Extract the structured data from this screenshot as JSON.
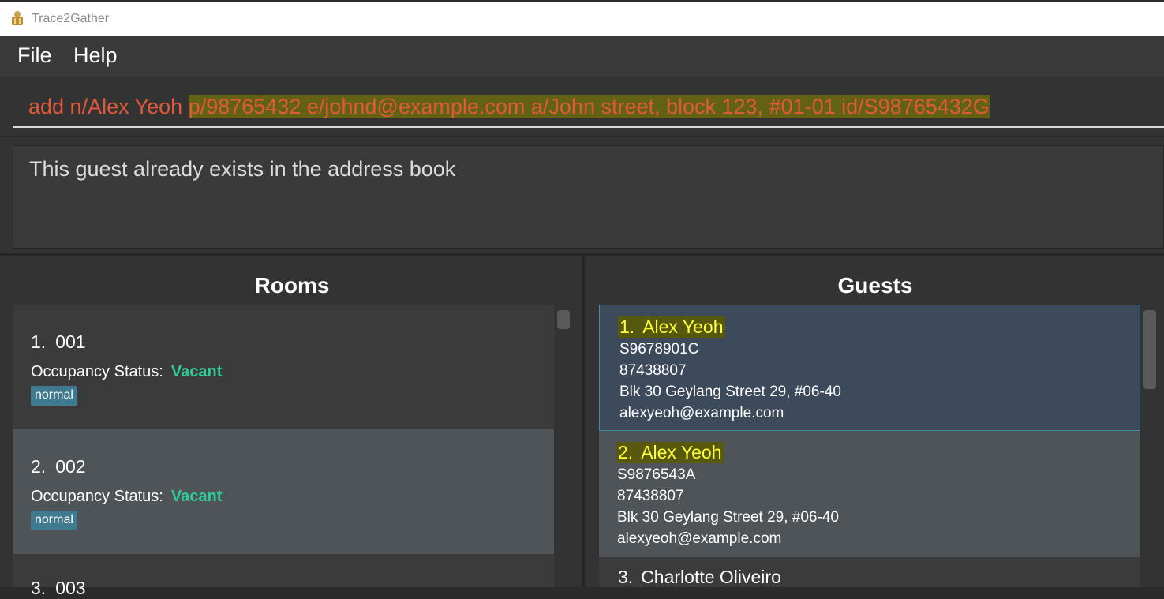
{
  "window": {
    "title": "Trace2Gather"
  },
  "menu": {
    "file": "File",
    "help": "Help"
  },
  "command": {
    "plain": "add n/Alex Yeoh ",
    "highlighted": "p/98765432 e/johnd@example.com a/John street, block 123, #01-01 id/S98765432G"
  },
  "result": {
    "text": "This guest already exists in the address book"
  },
  "rooms": {
    "title": "Rooms",
    "status_label": "Occupancy Status:",
    "items": [
      {
        "index": "1.",
        "number": "001",
        "status": "Vacant",
        "tag": "normal"
      },
      {
        "index": "2.",
        "number": "002",
        "status": "Vacant",
        "tag": "normal"
      },
      {
        "index": "3.",
        "number": "003"
      }
    ]
  },
  "guests": {
    "title": "Guests",
    "items": [
      {
        "index": "1.",
        "name": "Alex Yeoh",
        "id": "S9678901C",
        "phone": "87438807",
        "address": "Blk 30 Geylang Street 29, #06-40",
        "email": "alexyeoh@example.com"
      },
      {
        "index": "2.",
        "name": "Alex Yeoh",
        "id": "S9876543A",
        "phone": "87438807",
        "address": "Blk 30 Geylang Street 29, #06-40",
        "email": "alexyeoh@example.com"
      },
      {
        "index": "3.",
        "name": "Charlotte Oliveiro"
      }
    ]
  },
  "colors": {
    "vacant": "#2ecc95",
    "tag": "#3e7b91",
    "command_text": "#e05a3a",
    "guest_name": "#ffff3a"
  }
}
